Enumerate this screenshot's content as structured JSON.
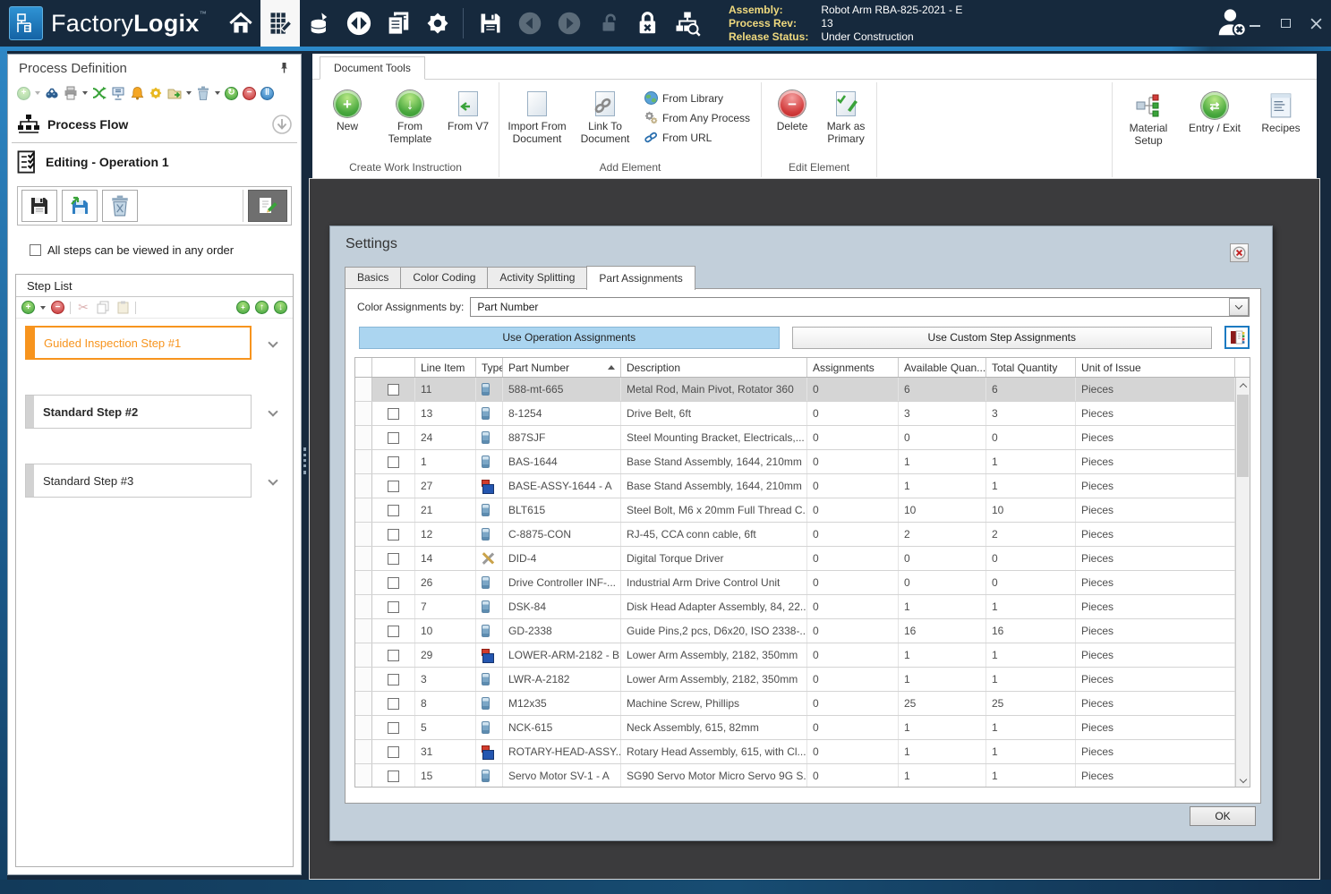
{
  "titlebar": {
    "brand_factory": "Factory",
    "brand_logix": "Logix",
    "tm": "™",
    "status_fields": [
      {
        "label": "Assembly:",
        "value": "Robot Arm RBA-825-2021 - E"
      },
      {
        "label": "Process Rev:",
        "value": "13"
      },
      {
        "label": "Release Status:",
        "value": "Under Construction"
      }
    ]
  },
  "left_panel": {
    "title": "Process Definition",
    "process_flow": "Process Flow",
    "editing": "Editing - Operation 1",
    "order_checkbox": "All steps can be viewed in any order",
    "step_list_title": "Step List",
    "steps": [
      {
        "label": "Guided Inspection Step #1",
        "style": "guided"
      },
      {
        "label": "Standard Step #2",
        "style": "bold"
      },
      {
        "label": "Standard Step #3",
        "style": "normal"
      }
    ]
  },
  "ribbon": {
    "tab_label": "Document Tools",
    "create_group": {
      "label": "Create Work Instruction",
      "new": "New",
      "from_template": "From Template",
      "from_v7": "From V7"
    },
    "add_group": {
      "label": "Add Element",
      "import": "Import From Document",
      "link": "Link To Document",
      "from_library": "From Library",
      "from_any_process": "From Any Process",
      "from_url": "From URL"
    },
    "edit_group": {
      "label": "Edit Element",
      "delete": "Delete",
      "mark_primary": "Mark as Primary"
    },
    "material_setup": "Material Setup",
    "entry_exit": "Entry / Exit",
    "recipes": "Recipes"
  },
  "settings": {
    "title": "Settings",
    "tabs": [
      "Basics",
      "Color Coding",
      "Activity Splitting",
      "Part Assignments"
    ],
    "color_by_label": "Color Assignments by:",
    "color_by_value": "Part Number",
    "operation_button": "Use Operation Assignments",
    "custom_button": "Use Custom Step Assignments",
    "ok": "OK",
    "table": {
      "headers": [
        "Line Item",
        "Type",
        "Part Number",
        "Description",
        "Assignments",
        "Available Quan...",
        "Total Quantity",
        "Unit of Issue"
      ],
      "rows": [
        {
          "line": "11",
          "type": "jar",
          "part": "588-mt-665",
          "desc": "Metal Rod, Main Pivot, Rotator 360",
          "assign": "0",
          "avail": "6",
          "total": "6",
          "unit": "Pieces",
          "selected": true
        },
        {
          "line": "13",
          "type": "jar",
          "part": "8-1254",
          "desc": "Drive Belt, 6ft",
          "assign": "0",
          "avail": "3",
          "total": "3",
          "unit": "Pieces",
          "selected": false
        },
        {
          "line": "24",
          "type": "jar",
          "part": "887SJF",
          "desc": "Steel Mounting Bracket, Electricals,...",
          "assign": "0",
          "avail": "0",
          "total": "0",
          "unit": "Pieces",
          "selected": false
        },
        {
          "line": "1",
          "type": "jar",
          "part": "BAS-1644",
          "desc": "Base Stand Assembly, 1644, 210mm",
          "assign": "0",
          "avail": "1",
          "total": "1",
          "unit": "Pieces",
          "selected": false
        },
        {
          "line": "27",
          "type": "assembly",
          "part": "BASE-ASSY-1644 - A",
          "desc": "Base Stand Assembly, 1644, 210mm",
          "assign": "0",
          "avail": "1",
          "total": "1",
          "unit": "Pieces",
          "selected": false
        },
        {
          "line": "21",
          "type": "jar",
          "part": "BLT615",
          "desc": "Steel Bolt, M6 x 20mm Full Thread C...",
          "assign": "0",
          "avail": "10",
          "total": "10",
          "unit": "Pieces",
          "selected": false
        },
        {
          "line": "12",
          "type": "jar",
          "part": "C-8875-CON",
          "desc": "RJ-45, CCA conn cable, 6ft",
          "assign": "0",
          "avail": "2",
          "total": "2",
          "unit": "Pieces",
          "selected": false
        },
        {
          "line": "14",
          "type": "tool",
          "part": "DID-4",
          "desc": "Digital Torque Driver",
          "assign": "0",
          "avail": "0",
          "total": "0",
          "unit": "Pieces",
          "selected": false
        },
        {
          "line": "26",
          "type": "jar",
          "part": "Drive Controller INF-...",
          "desc": "Industrial Arm Drive Control Unit",
          "assign": "0",
          "avail": "0",
          "total": "0",
          "unit": "Pieces",
          "selected": false
        },
        {
          "line": "7",
          "type": "jar",
          "part": "DSK-84",
          "desc": "Disk Head Adapter Assembly, 84, 22...",
          "assign": "0",
          "avail": "1",
          "total": "1",
          "unit": "Pieces",
          "selected": false
        },
        {
          "line": "10",
          "type": "jar",
          "part": "GD-2338",
          "desc": "Guide Pins,2 pcs, D6x20, ISO 2338-...",
          "assign": "0",
          "avail": "16",
          "total": "16",
          "unit": "Pieces",
          "selected": false
        },
        {
          "line": "29",
          "type": "assembly",
          "part": "LOWER-ARM-2182 - B",
          "desc": "Lower Arm Assembly, 2182, 350mm",
          "assign": "0",
          "avail": "1",
          "total": "1",
          "unit": "Pieces",
          "selected": false
        },
        {
          "line": "3",
          "type": "jar",
          "part": "LWR-A-2182",
          "desc": "Lower Arm Assembly, 2182, 350mm",
          "assign": "0",
          "avail": "1",
          "total": "1",
          "unit": "Pieces",
          "selected": false
        },
        {
          "line": "8",
          "type": "jar",
          "part": "M12x35",
          "desc": "Machine Screw, Phillips",
          "assign": "0",
          "avail": "25",
          "total": "25",
          "unit": "Pieces",
          "selected": false
        },
        {
          "line": "5",
          "type": "jar",
          "part": "NCK-615",
          "desc": "Neck Assembly, 615, 82mm",
          "assign": "0",
          "avail": "1",
          "total": "1",
          "unit": "Pieces",
          "selected": false
        },
        {
          "line": "31",
          "type": "assembly",
          "part": "ROTARY-HEAD-ASSY...",
          "desc": "Rotary Head Assembly, 615, with Cl...",
          "assign": "0",
          "avail": "1",
          "total": "1",
          "unit": "Pieces",
          "selected": false
        },
        {
          "line": "15",
          "type": "jar",
          "part": "Servo Motor SV-1 - A",
          "desc": "SG90 Servo Motor Micro Servo 9G S...",
          "assign": "0",
          "avail": "1",
          "total": "1",
          "unit": "Pieces",
          "selected": false
        }
      ]
    }
  },
  "colors": {
    "titlebar_bg": "#16293D",
    "accent_blue": "#1E7BC4",
    "guided_orange": "#F7941E",
    "dialog_bg": "#C2CFDA",
    "selection_gray": "#D5D5D5",
    "operation_button_blue": "#ABD5F0",
    "status_label_yellow": "#EFD97E",
    "content_dark": "#3B3B3D"
  }
}
